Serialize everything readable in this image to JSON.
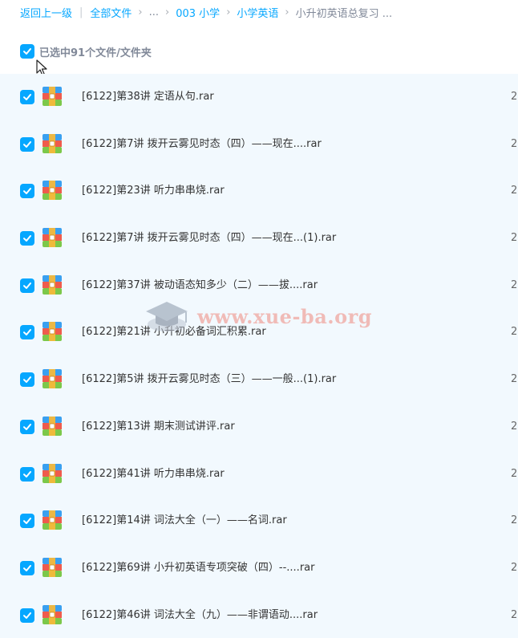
{
  "breadcrumb": {
    "back": "返回上一级",
    "all_files": "全部文件",
    "ellipsis": "...",
    "folder_1": "003 小学",
    "folder_2": "小学英语",
    "current": "小升初英语总复习 ...",
    "separator": "›",
    "divider": "|"
  },
  "selection": {
    "label": "已选中91个文件/文件夹",
    "checked": true
  },
  "watermark": {
    "text": "www.xue-ba.org"
  },
  "files": [
    {
      "name": "[6122]第38讲 定语从句.rar",
      "date": "2",
      "checked": true,
      "icon": "rar-archive-icon"
    },
    {
      "name": "[6122]第7讲 拨开云雾见时态（四）——现在....rar",
      "date": "2",
      "checked": true,
      "icon": "rar-archive-icon"
    },
    {
      "name": "[6122]第23讲 听力串串烧.rar",
      "date": "2",
      "checked": true,
      "icon": "rar-archive-icon"
    },
    {
      "name": "[6122]第7讲 拨开云雾见时态（四）——现在...(1).rar",
      "date": "2",
      "checked": true,
      "icon": "rar-archive-icon"
    },
    {
      "name": "[6122]第37讲 被动语态知多少（二）——拔....rar",
      "date": "2",
      "checked": true,
      "icon": "rar-archive-icon"
    },
    {
      "name": "[6122]第21讲 小升初必备词汇积累.rar",
      "date": "2",
      "checked": true,
      "icon": "rar-archive-icon"
    },
    {
      "name": "[6122]第5讲 拨开云雾见时态（三）——一般...(1).rar",
      "date": "2",
      "checked": true,
      "icon": "rar-archive-icon"
    },
    {
      "name": "[6122]第13讲 期末测试讲评.rar",
      "date": "2",
      "checked": true,
      "icon": "rar-archive-icon"
    },
    {
      "name": "[6122]第41讲 听力串串烧.rar",
      "date": "2",
      "checked": true,
      "icon": "rar-archive-icon"
    },
    {
      "name": "[6122]第14讲 词法大全（一）——名词.rar",
      "date": "2",
      "checked": true,
      "icon": "rar-archive-icon"
    },
    {
      "name": "[6122]第69讲 小升初英语专项突破（四）--....rar",
      "date": "2",
      "checked": true,
      "icon": "rar-archive-icon"
    },
    {
      "name": "[6122]第46讲 词法大全（九）——非谓语动....rar",
      "date": "2",
      "checked": true,
      "icon": "rar-archive-icon"
    }
  ],
  "colors": {
    "accent": "#06a7ff",
    "list_background": "#f2f9fe"
  }
}
